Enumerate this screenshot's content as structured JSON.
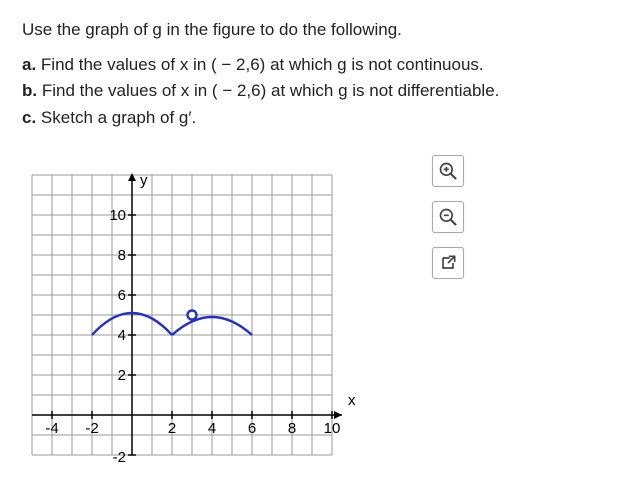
{
  "question": {
    "intro": "Use the graph of g in the figure to do the following.",
    "parts": {
      "a_label": "a.",
      "a_text": "Find the values of x in ( − 2,6) at which g is not continuous.",
      "b_label": "b.",
      "b_text": "Find the values of x in ( − 2,6) at which g is not differentiable.",
      "c_label": "c.",
      "c_text": "Sketch a graph of g′."
    }
  },
  "axes": {
    "x_label": "x",
    "y_label": "y",
    "y_ticks": [
      "10",
      "8",
      "6",
      "4",
      "2",
      "-2"
    ],
    "x_ticks_neg": [
      "-4",
      "-2"
    ],
    "x_ticks_pos": [
      "2",
      "4",
      "6",
      "8",
      "10"
    ]
  },
  "icons": {
    "zoom_in": "zoom-in-icon",
    "zoom_out": "zoom-out-icon",
    "popout": "popout-icon"
  },
  "chart_data": {
    "type": "line",
    "title": "",
    "xlabel": "x",
    "ylabel": "y",
    "xlim": [
      -5,
      10
    ],
    "ylim": [
      -2,
      10
    ],
    "series": [
      {
        "name": "g",
        "x": [
          -2,
          -1,
          0,
          1,
          2,
          3,
          4,
          5,
          6
        ],
        "y": [
          4,
          5.2,
          5.6,
          5.2,
          4,
          4.7,
          5.0,
          4.7,
          4
        ],
        "features": {
          "open_circle_at": {
            "x": 3,
            "y": 5
          },
          "corner_at_x": 2,
          "discontinuity_at_x": 3
        }
      }
    ]
  }
}
